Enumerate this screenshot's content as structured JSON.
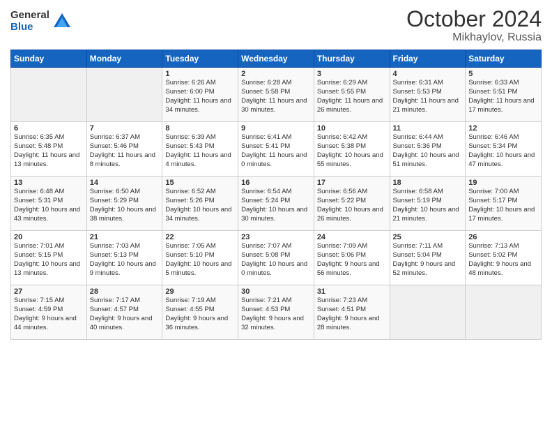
{
  "header": {
    "logo_general": "General",
    "logo_blue": "Blue",
    "month": "October 2024",
    "location": "Mikhaylov, Russia"
  },
  "weekdays": [
    "Sunday",
    "Monday",
    "Tuesday",
    "Wednesday",
    "Thursday",
    "Friday",
    "Saturday"
  ],
  "weeks": [
    [
      {
        "day": "",
        "sunrise": "",
        "sunset": "",
        "daylight": "",
        "empty": true
      },
      {
        "day": "",
        "sunrise": "",
        "sunset": "",
        "daylight": "",
        "empty": true
      },
      {
        "day": "1",
        "sunrise": "Sunrise: 6:26 AM",
        "sunset": "Sunset: 6:00 PM",
        "daylight": "Daylight: 11 hours and 34 minutes."
      },
      {
        "day": "2",
        "sunrise": "Sunrise: 6:28 AM",
        "sunset": "Sunset: 5:58 PM",
        "daylight": "Daylight: 11 hours and 30 minutes."
      },
      {
        "day": "3",
        "sunrise": "Sunrise: 6:29 AM",
        "sunset": "Sunset: 5:55 PM",
        "daylight": "Daylight: 11 hours and 26 minutes."
      },
      {
        "day": "4",
        "sunrise": "Sunrise: 6:31 AM",
        "sunset": "Sunset: 5:53 PM",
        "daylight": "Daylight: 11 hours and 21 minutes."
      },
      {
        "day": "5",
        "sunrise": "Sunrise: 6:33 AM",
        "sunset": "Sunset: 5:51 PM",
        "daylight": "Daylight: 11 hours and 17 minutes."
      }
    ],
    [
      {
        "day": "6",
        "sunrise": "Sunrise: 6:35 AM",
        "sunset": "Sunset: 5:48 PM",
        "daylight": "Daylight: 11 hours and 13 minutes."
      },
      {
        "day": "7",
        "sunrise": "Sunrise: 6:37 AM",
        "sunset": "Sunset: 5:46 PM",
        "daylight": "Daylight: 11 hours and 8 minutes."
      },
      {
        "day": "8",
        "sunrise": "Sunrise: 6:39 AM",
        "sunset": "Sunset: 5:43 PM",
        "daylight": "Daylight: 11 hours and 4 minutes."
      },
      {
        "day": "9",
        "sunrise": "Sunrise: 6:41 AM",
        "sunset": "Sunset: 5:41 PM",
        "daylight": "Daylight: 11 hours and 0 minutes."
      },
      {
        "day": "10",
        "sunrise": "Sunrise: 6:42 AM",
        "sunset": "Sunset: 5:38 PM",
        "daylight": "Daylight: 10 hours and 55 minutes."
      },
      {
        "day": "11",
        "sunrise": "Sunrise: 6:44 AM",
        "sunset": "Sunset: 5:36 PM",
        "daylight": "Daylight: 10 hours and 51 minutes."
      },
      {
        "day": "12",
        "sunrise": "Sunrise: 6:46 AM",
        "sunset": "Sunset: 5:34 PM",
        "daylight": "Daylight: 10 hours and 47 minutes."
      }
    ],
    [
      {
        "day": "13",
        "sunrise": "Sunrise: 6:48 AM",
        "sunset": "Sunset: 5:31 PM",
        "daylight": "Daylight: 10 hours and 43 minutes."
      },
      {
        "day": "14",
        "sunrise": "Sunrise: 6:50 AM",
        "sunset": "Sunset: 5:29 PM",
        "daylight": "Daylight: 10 hours and 38 minutes."
      },
      {
        "day": "15",
        "sunrise": "Sunrise: 6:52 AM",
        "sunset": "Sunset: 5:26 PM",
        "daylight": "Daylight: 10 hours and 34 minutes."
      },
      {
        "day": "16",
        "sunrise": "Sunrise: 6:54 AM",
        "sunset": "Sunset: 5:24 PM",
        "daylight": "Daylight: 10 hours and 30 minutes."
      },
      {
        "day": "17",
        "sunrise": "Sunrise: 6:56 AM",
        "sunset": "Sunset: 5:22 PM",
        "daylight": "Daylight: 10 hours and 26 minutes."
      },
      {
        "day": "18",
        "sunrise": "Sunrise: 6:58 AM",
        "sunset": "Sunset: 5:19 PM",
        "daylight": "Daylight: 10 hours and 21 minutes."
      },
      {
        "day": "19",
        "sunrise": "Sunrise: 7:00 AM",
        "sunset": "Sunset: 5:17 PM",
        "daylight": "Daylight: 10 hours and 17 minutes."
      }
    ],
    [
      {
        "day": "20",
        "sunrise": "Sunrise: 7:01 AM",
        "sunset": "Sunset: 5:15 PM",
        "daylight": "Daylight: 10 hours and 13 minutes."
      },
      {
        "day": "21",
        "sunrise": "Sunrise: 7:03 AM",
        "sunset": "Sunset: 5:13 PM",
        "daylight": "Daylight: 10 hours and 9 minutes."
      },
      {
        "day": "22",
        "sunrise": "Sunrise: 7:05 AM",
        "sunset": "Sunset: 5:10 PM",
        "daylight": "Daylight: 10 hours and 5 minutes."
      },
      {
        "day": "23",
        "sunrise": "Sunrise: 7:07 AM",
        "sunset": "Sunset: 5:08 PM",
        "daylight": "Daylight: 10 hours and 0 minutes."
      },
      {
        "day": "24",
        "sunrise": "Sunrise: 7:09 AM",
        "sunset": "Sunset: 5:06 PM",
        "daylight": "Daylight: 9 hours and 56 minutes."
      },
      {
        "day": "25",
        "sunrise": "Sunrise: 7:11 AM",
        "sunset": "Sunset: 5:04 PM",
        "daylight": "Daylight: 9 hours and 52 minutes."
      },
      {
        "day": "26",
        "sunrise": "Sunrise: 7:13 AM",
        "sunset": "Sunset: 5:02 PM",
        "daylight": "Daylight: 9 hours and 48 minutes."
      }
    ],
    [
      {
        "day": "27",
        "sunrise": "Sunrise: 7:15 AM",
        "sunset": "Sunset: 4:59 PM",
        "daylight": "Daylight: 9 hours and 44 minutes."
      },
      {
        "day": "28",
        "sunrise": "Sunrise: 7:17 AM",
        "sunset": "Sunset: 4:57 PM",
        "daylight": "Daylight: 9 hours and 40 minutes."
      },
      {
        "day": "29",
        "sunrise": "Sunrise: 7:19 AM",
        "sunset": "Sunset: 4:55 PM",
        "daylight": "Daylight: 9 hours and 36 minutes."
      },
      {
        "day": "30",
        "sunrise": "Sunrise: 7:21 AM",
        "sunset": "Sunset: 4:53 PM",
        "daylight": "Daylight: 9 hours and 32 minutes."
      },
      {
        "day": "31",
        "sunrise": "Sunrise: 7:23 AM",
        "sunset": "Sunset: 4:51 PM",
        "daylight": "Daylight: 9 hours and 28 minutes."
      },
      {
        "day": "",
        "sunrise": "",
        "sunset": "",
        "daylight": "",
        "empty": true
      },
      {
        "day": "",
        "sunrise": "",
        "sunset": "",
        "daylight": "",
        "empty": true
      }
    ]
  ]
}
